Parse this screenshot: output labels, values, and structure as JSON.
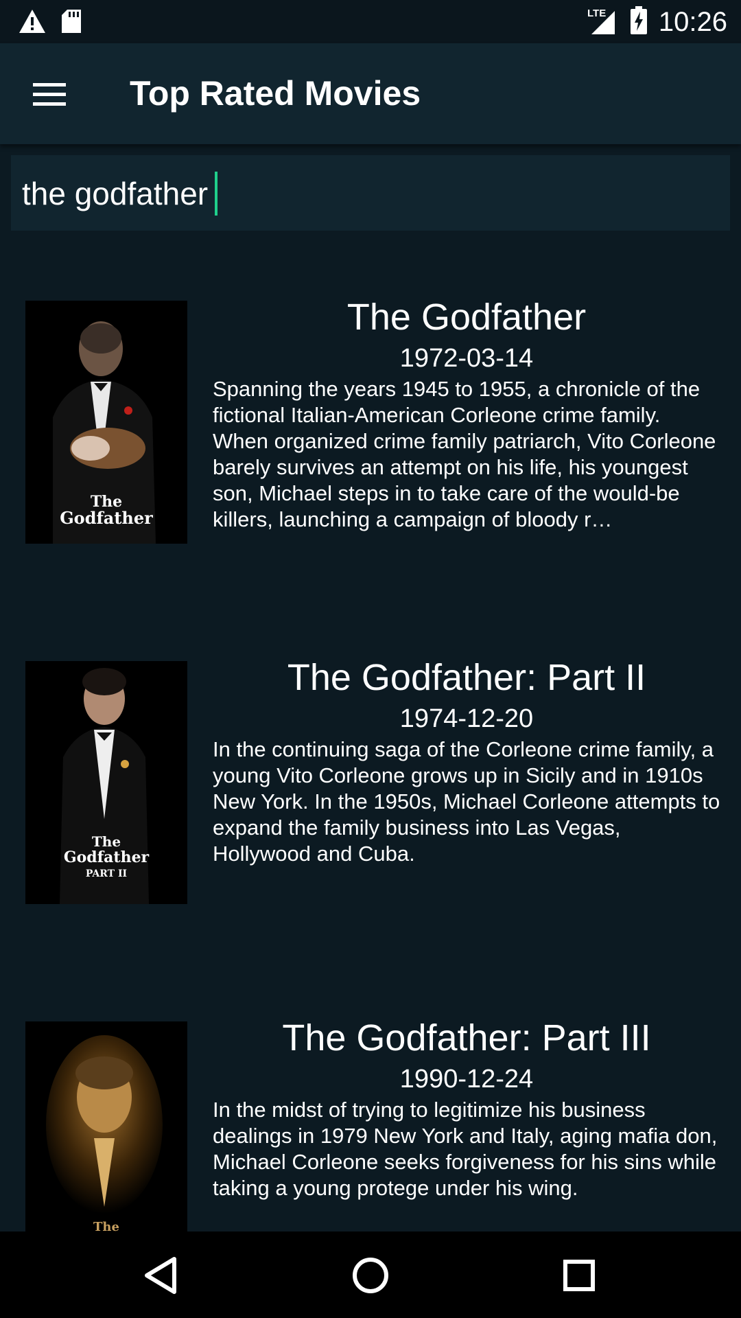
{
  "status_bar": {
    "time": "10:26",
    "network": "LTE",
    "icons": [
      "warning-icon",
      "sd-card-icon",
      "signal-icon",
      "battery-charging-icon"
    ]
  },
  "app_bar": {
    "title": "Top Rated Movies",
    "menu_icon": "hamburger-menu-icon"
  },
  "search": {
    "value": "the godfather",
    "placeholder": ""
  },
  "movies": [
    {
      "title": "The Godfather",
      "date": "1972-03-14",
      "overview": "Spanning the years 1945 to 1955, a chronicle of the fictional Italian-American Corleone crime family. When organized crime family patriarch, Vito Corleone barely survives an attempt on his life, his youngest son, Michael steps in to take care of the would-be killers, launching a campaign of bloody r…",
      "poster_text": "The Godfather"
    },
    {
      "title": "The Godfather: Part II",
      "date": "1974-12-20",
      "overview": "In the continuing saga of the Corleone crime family, a young Vito Corleone grows up in Sicily and in 1910s New York. In the 1950s, Michael Corleone attempts to expand the family business into Las Vegas, Hollywood and Cuba.",
      "poster_text": "The Godfather PART II"
    },
    {
      "title": "The Godfather: Part III",
      "date": "1990-12-24",
      "overview": "In the midst of trying to legitimize his business dealings in 1979 New York and Italy, aging mafia don, Michael Corleone seeks forgiveness for his sins while taking a young protege under his wing.",
      "poster_text": "The Godfather"
    }
  ],
  "nav_bar": {
    "buttons": [
      "back-icon",
      "home-icon",
      "recents-icon"
    ]
  },
  "colors": {
    "background": "#0c1a22",
    "app_bar": "#11252f",
    "accent": "#1fd08c"
  }
}
